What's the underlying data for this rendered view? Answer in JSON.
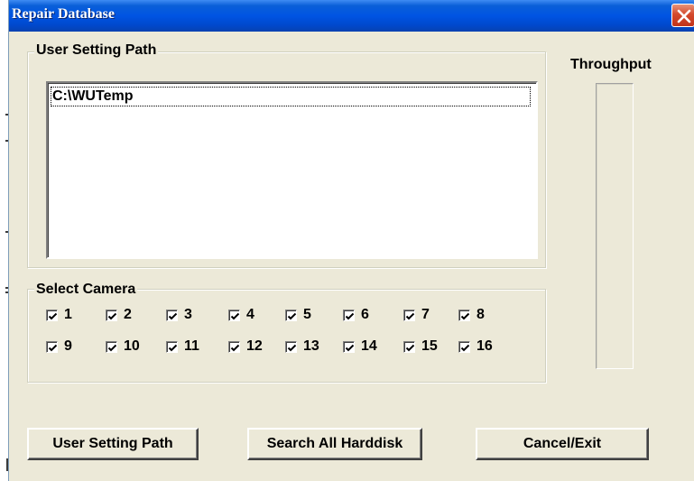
{
  "window": {
    "title": "Repair Database"
  },
  "user_setting_group": {
    "legend": "User Setting Path",
    "paths": [
      "C:\\WUTemp"
    ]
  },
  "throughput": {
    "label": "Throughput",
    "level": 0
  },
  "camera_group": {
    "legend": "Select Camera",
    "cameras": [
      {
        "label": "1",
        "checked": true
      },
      {
        "label": "2",
        "checked": true
      },
      {
        "label": "3",
        "checked": true
      },
      {
        "label": "4",
        "checked": true
      },
      {
        "label": "5",
        "checked": true
      },
      {
        "label": "6",
        "checked": true
      },
      {
        "label": "7",
        "checked": true
      },
      {
        "label": "8",
        "checked": true
      },
      {
        "label": "9",
        "checked": true
      },
      {
        "label": "10",
        "checked": true
      },
      {
        "label": "11",
        "checked": true
      },
      {
        "label": "12",
        "checked": true
      },
      {
        "label": "13",
        "checked": true
      },
      {
        "label": "14",
        "checked": true
      },
      {
        "label": "15",
        "checked": true
      },
      {
        "label": "16",
        "checked": true
      }
    ]
  },
  "buttons": {
    "user_setting_path": "User Setting Path",
    "search_all_harddisk": "Search All Harddisk",
    "cancel_exit": "Cancel/Exit"
  },
  "icons": {
    "close": "close-icon",
    "check": "checkmark-icon"
  },
  "colors": {
    "titlebar": "#0054e3",
    "dialog_bg": "#ece9d8",
    "close_button": "#d4492c"
  }
}
